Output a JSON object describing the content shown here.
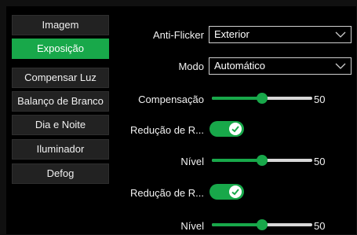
{
  "sidebar": {
    "items": [
      {
        "label": "Imagem",
        "active": false
      },
      {
        "label": "Exposição",
        "active": true
      },
      {
        "label": "Compensar Luz",
        "active": false
      },
      {
        "label": "Balanço de Branco",
        "active": false
      },
      {
        "label": "Dia e Noite",
        "active": false
      },
      {
        "label": "Iluminador",
        "active": false
      },
      {
        "label": "Defog",
        "active": false
      }
    ]
  },
  "settings": {
    "anti_flicker": {
      "label": "Anti-Flicker",
      "value": "Exterior"
    },
    "mode": {
      "label": "Modo",
      "value": "Automático"
    },
    "compensation": {
      "label": "Compensação",
      "value": "50",
      "fraction": 0.5
    },
    "reduction1": {
      "label": "Redução de R...",
      "on": true
    },
    "level1": {
      "label": "Nível",
      "value": "50",
      "fraction": 0.5
    },
    "reduction2": {
      "label": "Redução de R...",
      "on": true
    },
    "level2": {
      "label": "Nível",
      "value": "50",
      "fraction": 0.5
    }
  },
  "colors": {
    "accent": "#18a84a",
    "background": "#000000",
    "button": "#222222"
  },
  "icons": {
    "dropdown": "chevron-down-icon",
    "toggle_check": "check-icon"
  }
}
